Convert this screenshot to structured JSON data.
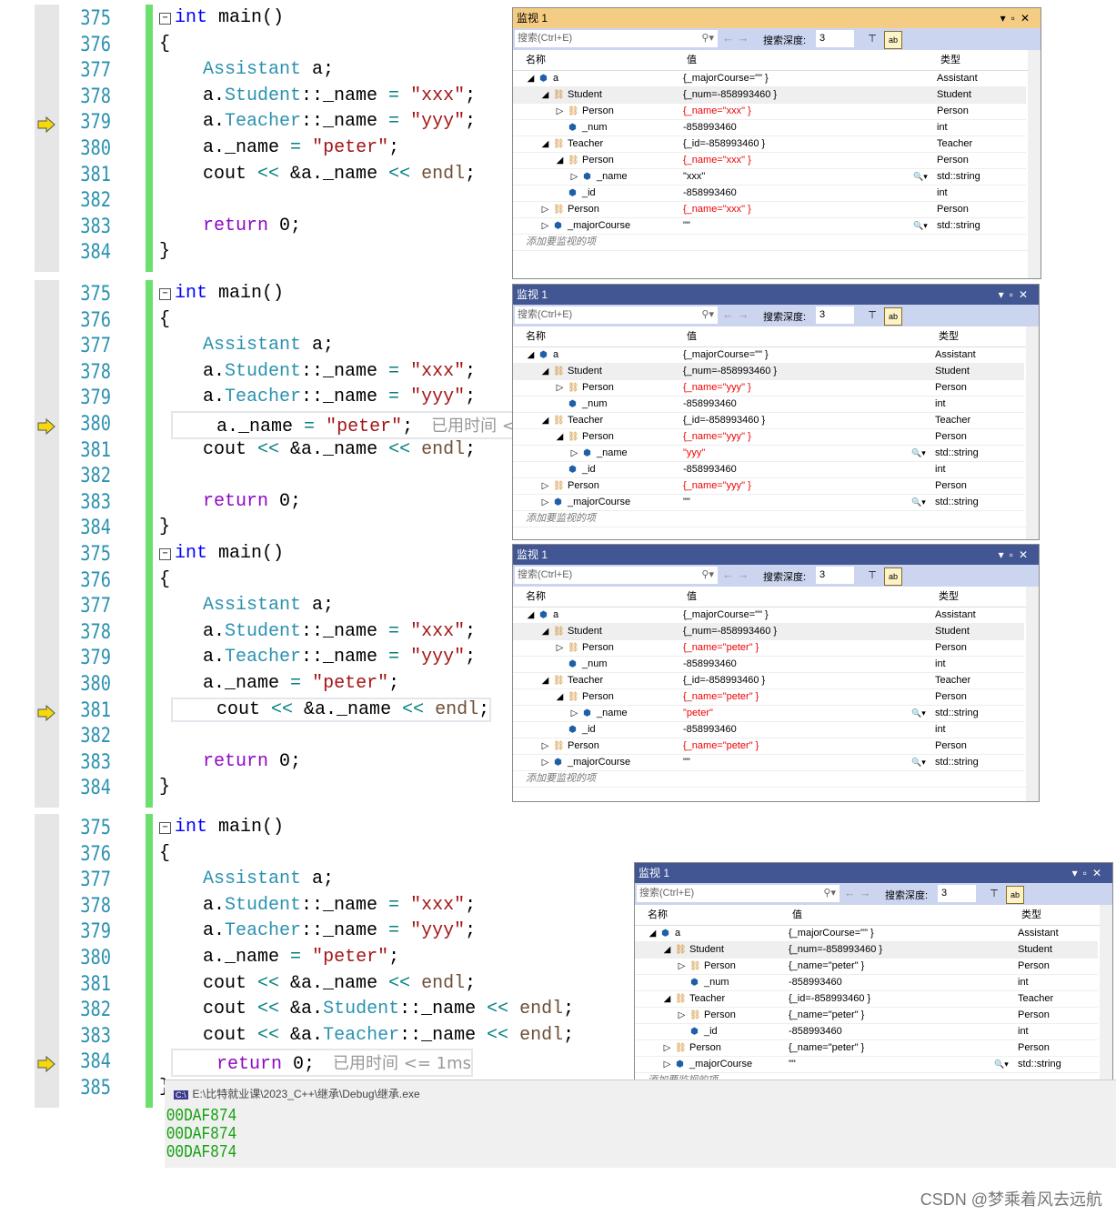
{
  "code_sections": [
    {
      "start": 375,
      "current": 379,
      "hint": "",
      "lines": [
        [
          [
            "int",
            "k"
          ],
          [
            " main()",
            ""
          ]
        ],
        [
          [
            "{",
            ""
          ]
        ],
        [
          [
            "    ",
            ""
          ],
          [
            "Assistant",
            "t"
          ],
          [
            " a;",
            ""
          ]
        ],
        [
          [
            "    a.",
            ""
          ],
          [
            "Student",
            "t"
          ],
          [
            "::_name ",
            ""
          ],
          [
            "=",
            "o"
          ],
          [
            " ",
            ""
          ],
          [
            "\"xxx\"",
            "s"
          ],
          [
            ";",
            ""
          ]
        ],
        [
          [
            "    a.",
            ""
          ],
          [
            "Teacher",
            "t"
          ],
          [
            "::_name ",
            ""
          ],
          [
            "=",
            "o"
          ],
          [
            " ",
            ""
          ],
          [
            "\"yyy\"",
            "s"
          ],
          [
            ";",
            ""
          ]
        ],
        [
          [
            "    a._name ",
            ""
          ],
          [
            "=",
            "o"
          ],
          [
            " ",
            ""
          ],
          [
            "\"peter\"",
            "s"
          ],
          [
            ";",
            ""
          ]
        ],
        [
          [
            "    cout ",
            ""
          ],
          [
            "<<",
            "o"
          ],
          [
            " &a._name ",
            ""
          ],
          [
            "<<",
            "o"
          ],
          [
            " ",
            ""
          ],
          [
            "endl",
            "e"
          ],
          [
            ";",
            ""
          ]
        ],
        [],
        [
          [
            "    ",
            ""
          ],
          [
            "return",
            "p"
          ],
          [
            " 0;",
            ""
          ]
        ],
        [
          [
            "}",
            ""
          ]
        ]
      ]
    },
    {
      "start": 375,
      "current": 380,
      "hint": "已用时间 <=",
      "lines": [
        [
          [
            "int",
            "k"
          ],
          [
            " main()",
            ""
          ]
        ],
        [
          [
            "{",
            ""
          ]
        ],
        [
          [
            "    ",
            ""
          ],
          [
            "Assistant",
            "t"
          ],
          [
            " a;",
            ""
          ]
        ],
        [
          [
            "    a.",
            ""
          ],
          [
            "Student",
            "t"
          ],
          [
            "::_name ",
            ""
          ],
          [
            "=",
            "o"
          ],
          [
            " ",
            ""
          ],
          [
            "\"xxx\"",
            "s"
          ],
          [
            ";",
            ""
          ]
        ],
        [
          [
            "    a.",
            ""
          ],
          [
            "Teacher",
            "t"
          ],
          [
            "::_name ",
            ""
          ],
          [
            "=",
            "o"
          ],
          [
            " ",
            ""
          ],
          [
            "\"yyy\"",
            "s"
          ],
          [
            ";",
            ""
          ]
        ],
        [
          [
            "    a._name ",
            ""
          ],
          [
            "=",
            "o"
          ],
          [
            " ",
            ""
          ],
          [
            "\"peter\"",
            "s"
          ],
          [
            ";",
            ""
          ]
        ],
        [
          [
            "    cout ",
            ""
          ],
          [
            "<<",
            "o"
          ],
          [
            " &a._name ",
            ""
          ],
          [
            "<<",
            "o"
          ],
          [
            " ",
            ""
          ],
          [
            "endl",
            "e"
          ],
          [
            ";",
            ""
          ]
        ],
        [],
        [
          [
            "    ",
            ""
          ],
          [
            "return",
            "p"
          ],
          [
            " 0;",
            ""
          ]
        ],
        [
          [
            "}",
            ""
          ]
        ]
      ]
    },
    {
      "start": 375,
      "current": 381,
      "hint": "",
      "lines": [
        [
          [
            "int",
            "k"
          ],
          [
            " main()",
            ""
          ]
        ],
        [
          [
            "{",
            ""
          ]
        ],
        [
          [
            "    ",
            ""
          ],
          [
            "Assistant",
            "t"
          ],
          [
            " a;",
            ""
          ]
        ],
        [
          [
            "    a.",
            ""
          ],
          [
            "Student",
            "t"
          ],
          [
            "::_name ",
            ""
          ],
          [
            "=",
            "o"
          ],
          [
            " ",
            ""
          ],
          [
            "\"xxx\"",
            "s"
          ],
          [
            ";",
            ""
          ]
        ],
        [
          [
            "    a.",
            ""
          ],
          [
            "Teacher",
            "t"
          ],
          [
            "::_name ",
            ""
          ],
          [
            "=",
            "o"
          ],
          [
            " ",
            ""
          ],
          [
            "\"yyy\"",
            "s"
          ],
          [
            ";",
            ""
          ]
        ],
        [
          [
            "    a._name ",
            ""
          ],
          [
            "=",
            "o"
          ],
          [
            " ",
            ""
          ],
          [
            "\"peter\"",
            "s"
          ],
          [
            ";",
            ""
          ]
        ],
        [
          [
            "    cout ",
            ""
          ],
          [
            "<<",
            "o"
          ],
          [
            " &a._name ",
            ""
          ],
          [
            "<<",
            "o"
          ],
          [
            " ",
            ""
          ],
          [
            "endl",
            "e"
          ],
          [
            ";",
            ""
          ]
        ],
        [],
        [
          [
            "    ",
            ""
          ],
          [
            "return",
            "p"
          ],
          [
            " 0;",
            ""
          ]
        ],
        [
          [
            "}",
            ""
          ]
        ]
      ]
    },
    {
      "start": 375,
      "current": 384,
      "hint": "已用时间 <= 1ms",
      "lines": [
        [
          [
            "int",
            "k"
          ],
          [
            " main()",
            ""
          ]
        ],
        [
          [
            "{",
            ""
          ]
        ],
        [
          [
            "    ",
            ""
          ],
          [
            "Assistant",
            "t"
          ],
          [
            " a;",
            ""
          ]
        ],
        [
          [
            "    a.",
            ""
          ],
          [
            "Student",
            "t"
          ],
          [
            "::_name ",
            ""
          ],
          [
            "=",
            "o"
          ],
          [
            " ",
            ""
          ],
          [
            "\"xxx\"",
            "s"
          ],
          [
            ";",
            ""
          ]
        ],
        [
          [
            "    a.",
            ""
          ],
          [
            "Teacher",
            "t"
          ],
          [
            "::_name ",
            ""
          ],
          [
            "=",
            "o"
          ],
          [
            " ",
            ""
          ],
          [
            "\"yyy\"",
            "s"
          ],
          [
            ";",
            ""
          ]
        ],
        [
          [
            "    a._name ",
            ""
          ],
          [
            "=",
            "o"
          ],
          [
            " ",
            ""
          ],
          [
            "\"peter\"",
            "s"
          ],
          [
            ";",
            ""
          ]
        ],
        [
          [
            "    cout ",
            ""
          ],
          [
            "<<",
            "o"
          ],
          [
            " &a._name ",
            ""
          ],
          [
            "<<",
            "o"
          ],
          [
            " ",
            ""
          ],
          [
            "endl",
            "e"
          ],
          [
            ";",
            ""
          ]
        ],
        [
          [
            "    cout ",
            ""
          ],
          [
            "<<",
            "o"
          ],
          [
            " &a.",
            ""
          ],
          [
            "Student",
            "t"
          ],
          [
            "::_name ",
            ""
          ],
          [
            "<<",
            "o"
          ],
          [
            " ",
            ""
          ],
          [
            "endl",
            "e"
          ],
          [
            ";",
            ""
          ]
        ],
        [
          [
            "    cout ",
            ""
          ],
          [
            "<<",
            "o"
          ],
          [
            " &a.",
            ""
          ],
          [
            "Teacher",
            "t"
          ],
          [
            "::_name ",
            ""
          ],
          [
            "<<",
            "o"
          ],
          [
            " ",
            ""
          ],
          [
            "endl",
            "e"
          ],
          [
            ";",
            ""
          ]
        ],
        [
          [
            "    ",
            ""
          ],
          [
            "return",
            "p"
          ],
          [
            " 0;",
            ""
          ]
        ],
        [
          [
            "}",
            ""
          ]
        ]
      ]
    }
  ],
  "watch_common": {
    "title": "监视 1",
    "search_placeholder": "搜索(Ctrl+E)",
    "depth_label": "搜索深度:",
    "depth_value": "3",
    "col_name": "名称",
    "col_value": "值",
    "col_type": "类型",
    "add_item": "添加要监视的项"
  },
  "watch_colors": {
    "active_title": "#f5cc84",
    "inactive_title": "#425693",
    "toolbar": "#ccd5f0",
    "red_value": "#e00000"
  },
  "watch_panels": [
    {
      "active": true,
      "rows": [
        [
          0,
          "open",
          "obj",
          "a",
          "{_majorCourse=\"\" }",
          false,
          "Assistant",
          false
        ],
        [
          1,
          "open",
          "base",
          "Student",
          "{_num=-858993460 }",
          false,
          "Student",
          false
        ],
        [
          2,
          "closed",
          "base",
          "Person",
          "{_name=\"xxx\" }",
          true,
          "Person",
          false
        ],
        [
          2,
          "",
          "field",
          "_num",
          "-858993460",
          false,
          "int",
          false
        ],
        [
          1,
          "open",
          "base",
          "Teacher",
          "{_id=-858993460 }",
          false,
          "Teacher",
          false
        ],
        [
          2,
          "open",
          "base",
          "Person",
          "{_name=\"xxx\" }",
          true,
          "Person",
          false
        ],
        [
          3,
          "closed",
          "obj",
          "_name",
          "\"xxx\"",
          false,
          "std::string",
          true
        ],
        [
          2,
          "",
          "field",
          "_id",
          "-858993460",
          false,
          "int",
          false
        ],
        [
          1,
          "closed",
          "base",
          "Person",
          "{_name=\"xxx\" }",
          true,
          "Person",
          false
        ],
        [
          1,
          "closed",
          "field",
          "_majorCourse",
          "\"\"",
          false,
          "std::string",
          true
        ]
      ]
    },
    {
      "active": false,
      "rows": [
        [
          0,
          "open",
          "obj",
          "a",
          "{_majorCourse=\"\" }",
          false,
          "Assistant",
          false
        ],
        [
          1,
          "open",
          "base",
          "Student",
          "{_num=-858993460 }",
          false,
          "Student",
          false
        ],
        [
          2,
          "closed",
          "base",
          "Person",
          "{_name=\"yyy\" }",
          true,
          "Person",
          false
        ],
        [
          2,
          "",
          "field",
          "_num",
          "-858993460",
          false,
          "int",
          false
        ],
        [
          1,
          "open",
          "base",
          "Teacher",
          "{_id=-858993460 }",
          false,
          "Teacher",
          false
        ],
        [
          2,
          "open",
          "base",
          "Person",
          "{_name=\"yyy\" }",
          true,
          "Person",
          false
        ],
        [
          3,
          "closed",
          "obj",
          "_name",
          "\"yyy\"",
          true,
          "std::string",
          true
        ],
        [
          2,
          "",
          "field",
          "_id",
          "-858993460",
          false,
          "int",
          false
        ],
        [
          1,
          "closed",
          "base",
          "Person",
          "{_name=\"yyy\" }",
          true,
          "Person",
          false
        ],
        [
          1,
          "closed",
          "field",
          "_majorCourse",
          "\"\"",
          false,
          "std::string",
          true
        ]
      ]
    },
    {
      "active": false,
      "rows": [
        [
          0,
          "open",
          "obj",
          "a",
          "{_majorCourse=\"\" }",
          false,
          "Assistant",
          false
        ],
        [
          1,
          "open",
          "base",
          "Student",
          "{_num=-858993460 }",
          false,
          "Student",
          false
        ],
        [
          2,
          "closed",
          "base",
          "Person",
          "{_name=\"peter\" }",
          true,
          "Person",
          false
        ],
        [
          2,
          "",
          "field",
          "_num",
          "-858993460",
          false,
          "int",
          false
        ],
        [
          1,
          "open",
          "base",
          "Teacher",
          "{_id=-858993460 }",
          false,
          "Teacher",
          false
        ],
        [
          2,
          "open",
          "base",
          "Person",
          "{_name=\"peter\" }",
          true,
          "Person",
          false
        ],
        [
          3,
          "closed",
          "obj",
          "_name",
          "\"peter\"",
          true,
          "std::string",
          true
        ],
        [
          2,
          "",
          "field",
          "_id",
          "-858993460",
          false,
          "int",
          false
        ],
        [
          1,
          "closed",
          "base",
          "Person",
          "{_name=\"peter\" }",
          true,
          "Person",
          false
        ],
        [
          1,
          "closed",
          "field",
          "_majorCourse",
          "\"\"",
          false,
          "std::string",
          true
        ]
      ]
    },
    {
      "active": false,
      "rows": [
        [
          0,
          "open",
          "obj",
          "a",
          "{_majorCourse=\"\" }",
          false,
          "Assistant",
          false
        ],
        [
          1,
          "open",
          "base",
          "Student",
          "{_num=-858993460 }",
          false,
          "Student",
          false
        ],
        [
          2,
          "closed",
          "base",
          "Person",
          "{_name=\"peter\" }",
          false,
          "Person",
          false
        ],
        [
          2,
          "",
          "field",
          "_num",
          "-858993460",
          false,
          "int",
          false
        ],
        [
          1,
          "open",
          "base",
          "Teacher",
          "{_id=-858993460 }",
          false,
          "Teacher",
          false
        ],
        [
          2,
          "closed",
          "base",
          "Person",
          "{_name=\"peter\" }",
          false,
          "Person",
          false
        ],
        [
          2,
          "",
          "field",
          "_id",
          "-858993460",
          false,
          "int",
          false
        ],
        [
          1,
          "closed",
          "base",
          "Person",
          "{_name=\"peter\" }",
          false,
          "Person",
          false
        ],
        [
          1,
          "closed",
          "field",
          "_majorCourse",
          "\"\"",
          false,
          "std::string",
          true
        ]
      ]
    }
  ],
  "console": {
    "title": "E:\\比特就业课\\2023_C++\\继承\\Debug\\继承.exe",
    "output": [
      "00DAF874",
      "00DAF874",
      "00DAF874"
    ]
  },
  "watermark": "CSDN @梦乘着风去远航"
}
